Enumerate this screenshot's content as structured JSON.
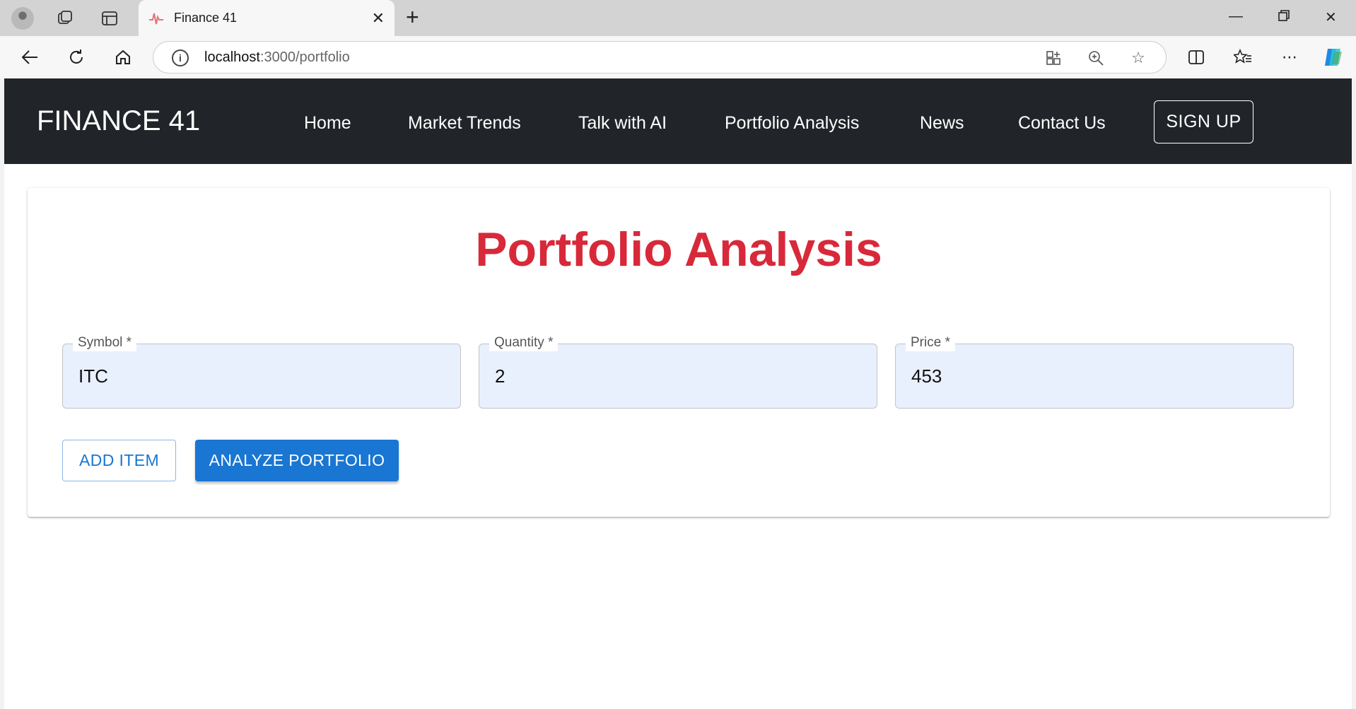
{
  "browser": {
    "tab_title": "Finance 41",
    "url_host": "localhost",
    "url_path": ":3000/portfolio",
    "icons": [
      "profile-avatar",
      "collections-icon",
      "tab-actions-icon",
      "close-icon",
      "new-tab-icon",
      "minimize-icon",
      "restore-icon",
      "window-close-icon",
      "back-icon",
      "refresh-icon",
      "home-icon",
      "site-info-icon",
      "app-available-icon",
      "zoom-icon",
      "favorite-star-icon",
      "split-screen-icon",
      "favorites-icon",
      "more-icon",
      "copilot-icon"
    ]
  },
  "navbar": {
    "brand": "FINANCE 41",
    "links": [
      "Home",
      "Market Trends",
      "Talk with AI",
      "Portfolio Analysis",
      "News",
      "Contact Us"
    ],
    "signup_label": "SIGN UP",
    "background": "#212529"
  },
  "main": {
    "title": "Portfolio Analysis",
    "title_color": "#d8293a",
    "fields": [
      {
        "label": "Symbol *",
        "value": "ITC"
      },
      {
        "label": "Quantity *",
        "value": "2"
      },
      {
        "label": "Price *",
        "value": "453"
      }
    ],
    "add_item_label": "ADD ITEM",
    "analyze_label": "ANALYZE PORTFOLIO",
    "accent": "#1976d2"
  }
}
